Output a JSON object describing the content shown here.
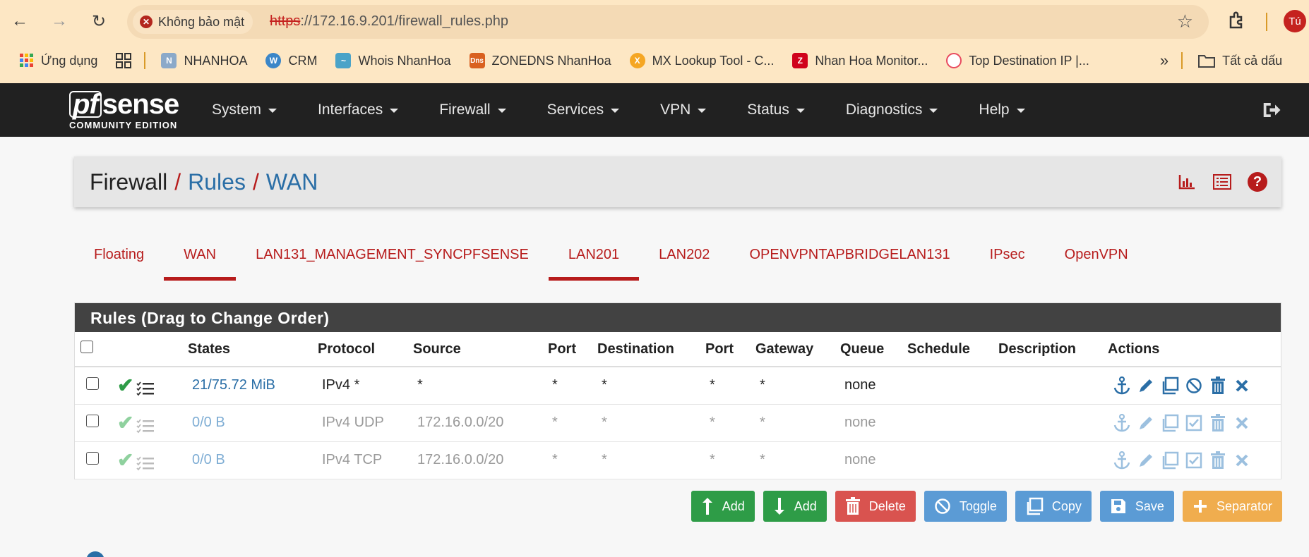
{
  "browser": {
    "security_label": "Không bảo mật",
    "url_protocol": "https",
    "url_rest": "://172.16.9.201/firewall_rules.php",
    "profile_initial": "Tú",
    "bookmarks": [
      {
        "label": "Ứng dụng",
        "icon": "apps-grid-icon"
      },
      {
        "label": "NHANHOA",
        "icon": "nhanhoa-favicon"
      },
      {
        "label": "CRM",
        "icon": "wordpress-icon"
      },
      {
        "label": "Whois NhanHoa",
        "icon": "whois-favicon"
      },
      {
        "label": "ZONEDNS NhanHoa",
        "icon": "dns-favicon"
      },
      {
        "label": "MX Lookup Tool - C...",
        "icon": "mxtoolbox-favicon"
      },
      {
        "label": "Nhan Hoa Monitor...",
        "icon": "zabbix-favicon"
      },
      {
        "label": "Top Destination IP |...",
        "icon": "gauge-favicon"
      }
    ],
    "all_bookmarks": "Tất cả dấu"
  },
  "pfsense": {
    "logo_main": "sense",
    "logo_pf": "pf",
    "logo_sub": "COMMUNITY EDITION",
    "menu": [
      "System",
      "Interfaces",
      "Firewall",
      "Services",
      "VPN",
      "Status",
      "Diagnostics",
      "Help"
    ]
  },
  "breadcrumb": {
    "root": "Firewall",
    "level1": "Rules",
    "level2": "WAN"
  },
  "tabs": [
    {
      "label": "Floating",
      "active": false
    },
    {
      "label": "WAN",
      "active": true
    },
    {
      "label": "LAN131_MANAGEMENT_SYNCPFSENSE",
      "active": false
    },
    {
      "label": "LAN201",
      "active": true
    },
    {
      "label": "LAN202",
      "active": false
    },
    {
      "label": "OPENVPNTAPBRIDGELAN131",
      "active": false
    },
    {
      "label": "IPsec",
      "active": false
    },
    {
      "label": "OpenVPN",
      "active": false
    }
  ],
  "rules": {
    "title": "Rules (Drag to Change Order)",
    "headers": {
      "states": "States",
      "protocol": "Protocol",
      "source": "Source",
      "port": "Port",
      "destination": "Destination",
      "port2": "Port",
      "gateway": "Gateway",
      "queue": "Queue",
      "schedule": "Schedule",
      "description": "Description",
      "actions": "Actions"
    },
    "rows": [
      {
        "states": "21/75.72 MiB",
        "protocol": "IPv4 *",
        "source": "*",
        "port": "*",
        "destination": "*",
        "port2": "*",
        "gateway": "*",
        "queue": "none",
        "schedule": "",
        "description": "",
        "disabled": false
      },
      {
        "states": "0/0 B",
        "protocol": "IPv4 UDP",
        "source": "172.16.0.0/20",
        "port": "*",
        "destination": "*",
        "port2": "*",
        "gateway": "*",
        "queue": "none",
        "schedule": "",
        "description": "",
        "disabled": true
      },
      {
        "states": "0/0 B",
        "protocol": "IPv4 TCP",
        "source": "172.16.0.0/20",
        "port": "*",
        "destination": "*",
        "port2": "*",
        "gateway": "*",
        "queue": "none",
        "schedule": "",
        "description": "",
        "disabled": true
      }
    ]
  },
  "buttons": {
    "add_top": "Add",
    "add_bottom": "Add",
    "delete": "Delete",
    "toggle": "Toggle",
    "copy": "Copy",
    "save": "Save",
    "separator": "Separator"
  }
}
